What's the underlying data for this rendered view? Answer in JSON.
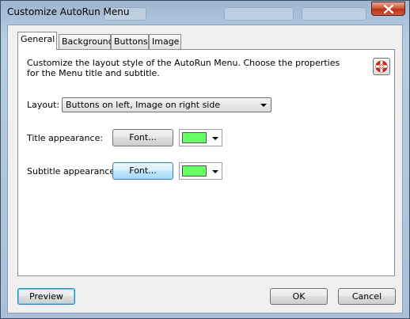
{
  "window": {
    "title": "Customize AutoRun Menu"
  },
  "tabs": [
    {
      "label": "General",
      "active": true
    },
    {
      "label": "Background",
      "active": false
    },
    {
      "label": "Buttons",
      "active": false
    },
    {
      "label": "Image",
      "active": false
    }
  ],
  "general": {
    "description": "Customize the layout style of the AutoRun Menu. Choose the properties for the Menu title and subtitle.",
    "layout_label": "Layout:",
    "layout_value": "Buttons on left, Image on right side",
    "title_label": "Title appearance:",
    "title_font_button": "Font...",
    "title_color": "#66ff66",
    "subtitle_label": "Subtitle appearance:",
    "subtitle_font_button": "Font...",
    "subtitle_color": "#66ff66",
    "help_icon": "lifebuoy-icon"
  },
  "footer": {
    "preview_label": "Preview",
    "ok_label": "OK",
    "cancel_label": "Cancel"
  }
}
